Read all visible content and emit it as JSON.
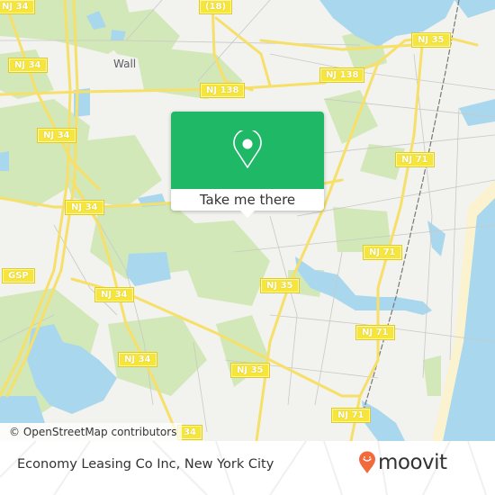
{
  "map": {
    "place_labels": [
      {
        "id": "wall",
        "text": "Wall"
      }
    ],
    "road_shields": [
      {
        "id": "nj34-a",
        "text": "NJ 34"
      },
      {
        "id": "us18",
        "text": "(18)"
      },
      {
        "id": "nj35-a",
        "text": "NJ 35"
      },
      {
        "id": "nj138-a",
        "text": "NJ 138"
      },
      {
        "id": "nj34-b",
        "text": "NJ 34"
      },
      {
        "id": "nj138-b",
        "text": "NJ 138"
      },
      {
        "id": "nj34-c",
        "text": "NJ 34"
      },
      {
        "id": "nj71-a",
        "text": "NJ 71"
      },
      {
        "id": "nj34-d",
        "text": "NJ 34"
      },
      {
        "id": "nj71-b",
        "text": "NJ 71"
      },
      {
        "id": "gsp",
        "text": "GSP"
      },
      {
        "id": "nj34-e",
        "text": "NJ 34"
      },
      {
        "id": "nj35-b",
        "text": "NJ 35"
      },
      {
        "id": "nj71-c",
        "text": "NJ 71"
      },
      {
        "id": "nj34-f",
        "text": "NJ 34"
      },
      {
        "id": "nj35-c",
        "text": "NJ 35"
      },
      {
        "id": "nj71-d",
        "text": "NJ 71"
      },
      {
        "id": "nj34-g",
        "text": "34"
      }
    ],
    "attribution": "© OpenStreetMap contributors",
    "colors": {
      "land": "#f2f2ee",
      "park": "#d3e8b8",
      "water": "#a9d8ee",
      "road": "#f6e06a",
      "shield": "#f6e53a",
      "beach": "#fbf3cf"
    }
  },
  "popup": {
    "icon": "map-pin-icon",
    "button_label": "Take me there",
    "color": "#1eb866"
  },
  "footer": {
    "title": "Economy Leasing Co Inc, New York City",
    "logo_text": "moovit",
    "logo_icon": "moovit-pin-icon",
    "logo_color": "#f26a3c"
  }
}
